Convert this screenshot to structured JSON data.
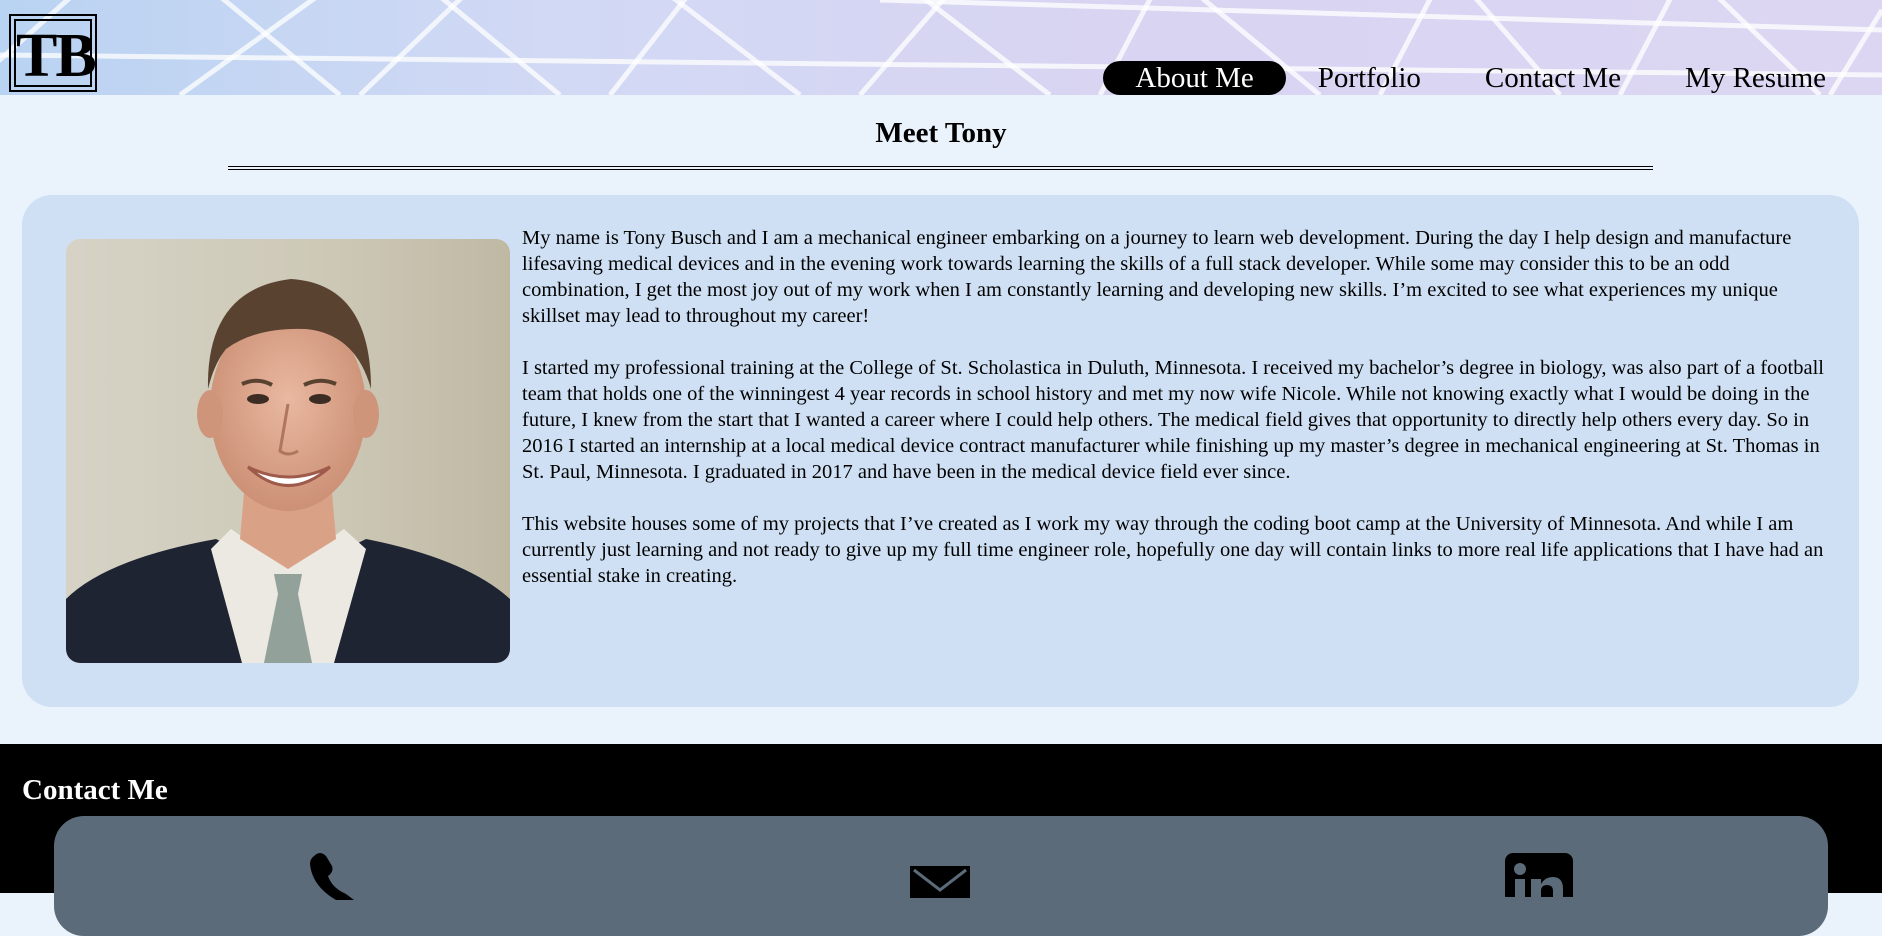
{
  "header": {
    "logo_text": "TB",
    "nav": [
      {
        "label": "About Me",
        "active": true
      },
      {
        "label": "Portfolio",
        "active": false
      },
      {
        "label": "Contact Me",
        "active": false
      },
      {
        "label": "My Resume",
        "active": false
      }
    ]
  },
  "main": {
    "title": "Meet Tony",
    "paragraphs": [
      "My name is Tony Busch and I am a mechanical engineer embarking on a journey to learn web development. During the day I help design and manufacture lifesaving medical devices and in the evening work towards learning the skills of a full stack developer. While some may consider this to be an odd combination, I get the most joy out of my work when I am constantly learning and developing new skills. I’m excited to see what experiences my unique skillset may lead to throughout my career!",
      "I started my professional training at the College of St. Scholastica in Duluth, Minnesota. I received my bachelor’s degree in biology, was also part of a football team that holds one of the winningest 4 year records in school history and met my now wife Nicole. While not knowing exactly what I would be doing in the future, I knew from the start that I wanted a career where I could help others. The medical field gives that opportunity to directly help others every day. So in 2016 I started an internship at a local medical device contract manufacturer while finishing up my master’s degree in mechanical engineering at St. Thomas in St. Paul, Minnesota. I graduated in 2017 and have been in the medical device field ever since.",
      "This website houses some of my projects that I’ve created as I work my way through the coding boot camp at the University of Minnesota. And while I am currently just learning and not ready to give up my full time engineer role, hopefully one day will contain links to more real life applications that I have had an essential stake in creating."
    ]
  },
  "footer": {
    "title": "Contact Me",
    "icons": [
      "phone-icon",
      "email-icon",
      "linkedin-icon"
    ]
  },
  "colors": {
    "page_bg": "#eaf2fc",
    "card_bg": "#cfe0f4",
    "footer_bg": "#000000",
    "contact_panel_bg": "#5b6b79",
    "nav_active_bg": "#000000"
  }
}
